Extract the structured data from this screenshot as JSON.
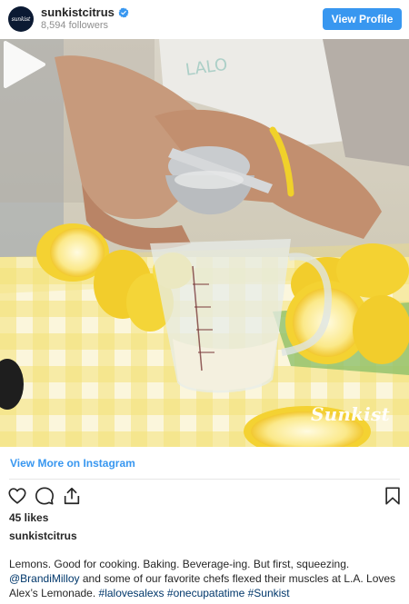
{
  "header": {
    "avatar_text": "sunkist",
    "username": "sunkistcitrus",
    "followers": "8,594 followers",
    "view_profile_label": "View Profile",
    "verified_color": "#3897f0"
  },
  "media": {
    "type": "video",
    "watermark": "Sunkist",
    "play_icon": "play-icon"
  },
  "footer": {
    "view_more_label": "View More on Instagram",
    "actions": [
      "heart-icon",
      "comment-icon",
      "share-icon",
      "bookmark-icon"
    ],
    "likes": "45 likes",
    "caption_user": "sunkistcitrus",
    "caption_line1": "Lemons. Good for cooking. Baking. Beverage-ing. But first, squeezing.",
    "mention": "@BrandiMilloy",
    "caption_mid": " and some of our favorite chefs flexed their muscles at L.A. Loves Alex’s Lemonade. ",
    "hashtags": "#lalovesalexs #onecupatatime #Sunkist"
  },
  "colors": {
    "accent": "#3897f0",
    "text": "#262626",
    "secondary": "#8e8e8e",
    "link": "#00376b"
  }
}
